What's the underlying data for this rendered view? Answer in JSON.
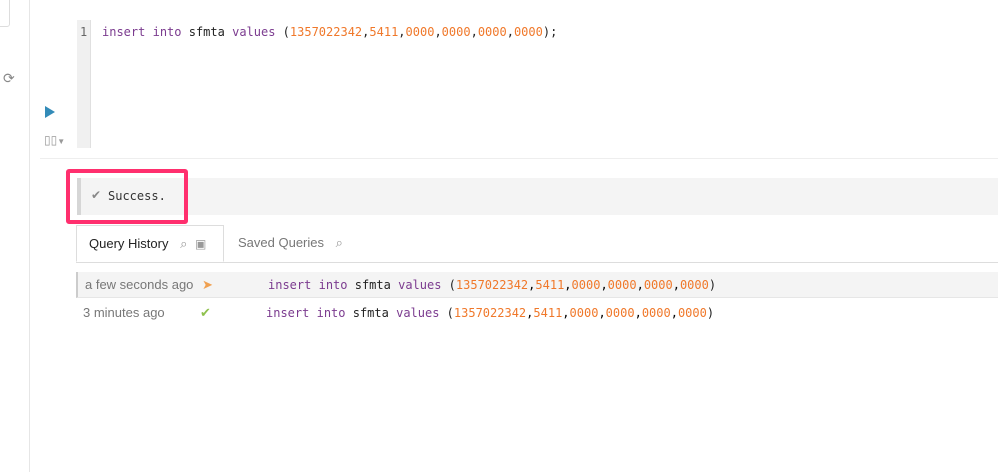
{
  "editor": {
    "line_number": "1",
    "code": {
      "kw1": "insert",
      "kw2": "into",
      "table": "sfmta",
      "kw3": "values",
      "open": " (",
      "n1": "1357022342",
      "n2": "5411",
      "n3": "0000",
      "n4": "0000",
      "n5": "0000",
      "n6": "0000",
      "close": ");"
    }
  },
  "result": {
    "message": "Success."
  },
  "tabs": [
    {
      "label": "Query History"
    },
    {
      "label": "Saved Queries"
    }
  ],
  "history": [
    {
      "time": "a few seconds ago",
      "status": "running",
      "query": {
        "kw1": "insert",
        "kw2": "into",
        "table": "sfmta",
        "kw3": "values",
        "open": " (",
        "n1": "1357022342",
        "n2": "5411",
        "n3": "0000",
        "n4": "0000",
        "n5": "0000",
        "n6": "0000",
        "close": ")"
      }
    },
    {
      "time": "3 minutes ago",
      "status": "success",
      "query": {
        "kw1": "insert",
        "kw2": "into",
        "table": "sfmta",
        "kw3": "values",
        "open": " (",
        "n1": "1357022342",
        "n2": "5411",
        "n3": "0000",
        "n4": "0000",
        "n5": "0000",
        "n6": "0000",
        "close": ")"
      }
    }
  ],
  "colors": {
    "highlight": "#ff2f6e",
    "run": "#338bb8",
    "keyword": "#7b3b8f",
    "number": "#f0782a",
    "success": "#8fc14e",
    "running": "#f0a050"
  }
}
